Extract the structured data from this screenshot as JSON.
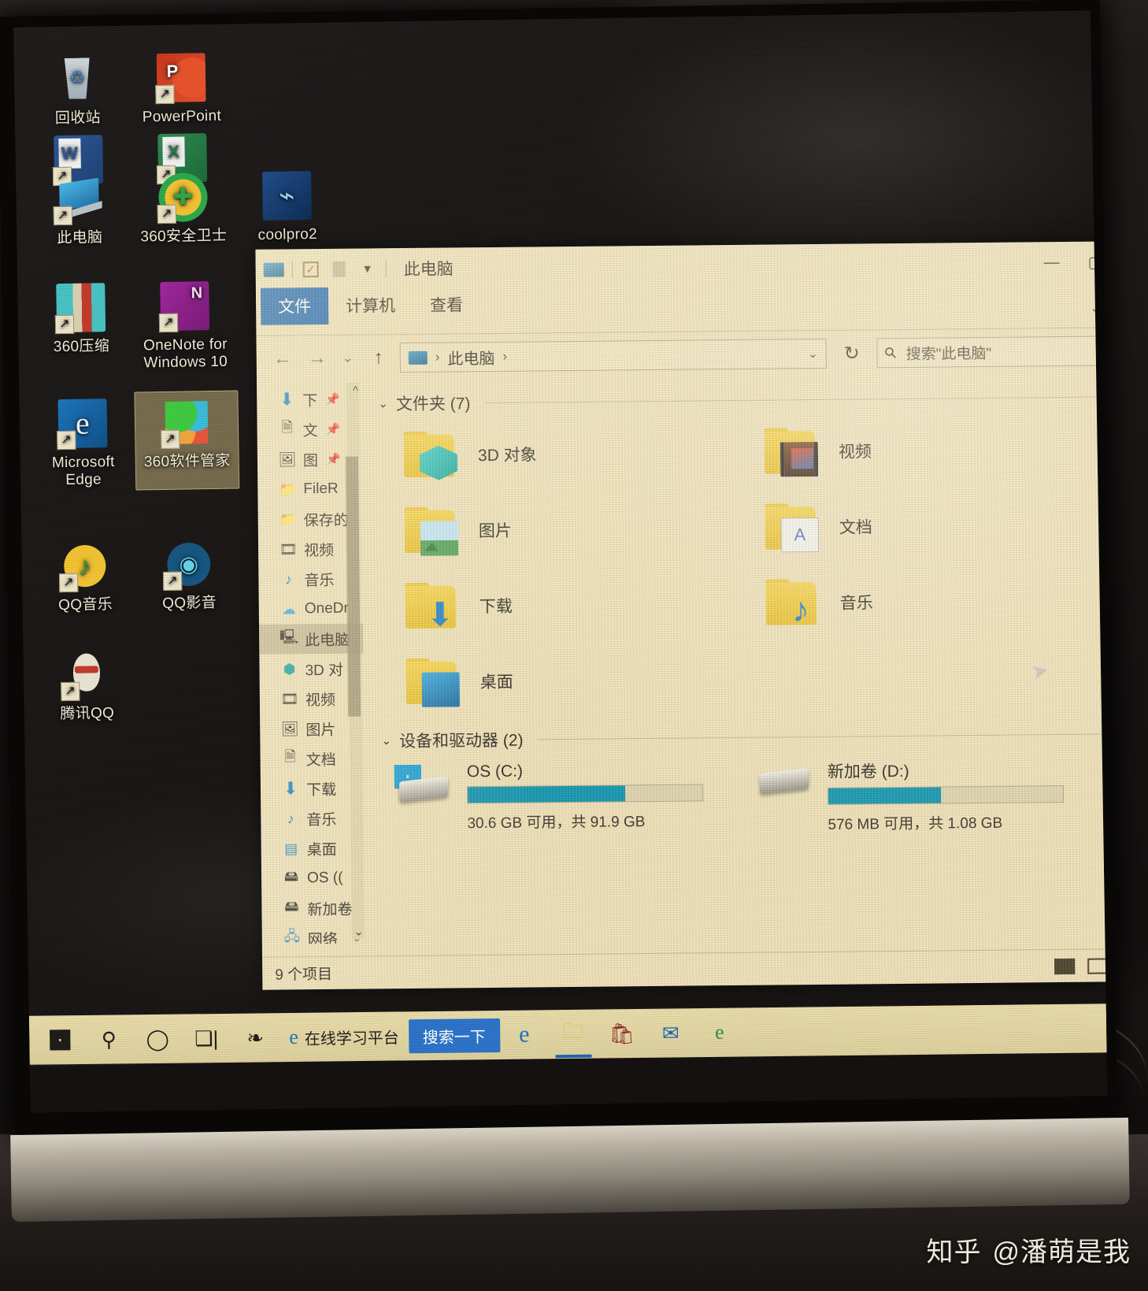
{
  "desktop": {
    "icons": [
      {
        "label": "回收站",
        "art": "i-recycle",
        "shortcut": false,
        "selected": false
      },
      {
        "label": "PowerPoint",
        "art": "i-ppt",
        "letter": "P",
        "shortcut": true,
        "selected": false
      },
      {
        "label": "Word",
        "art": "i-word",
        "letter": "W",
        "shortcut": true,
        "selected": false
      },
      {
        "label": "Excel",
        "art": "i-excel",
        "letter": "X",
        "shortcut": true,
        "selected": false
      },
      {
        "label": "此电脑",
        "art": "i-pc",
        "shortcut": true,
        "selected": false
      },
      {
        "label": "360安全卫士",
        "art": "i-360",
        "shortcut": true,
        "selected": false
      },
      {
        "label": "coolpro2",
        "art": "i-cool",
        "shortcut": false,
        "selected": false
      },
      {
        "label": "360压缩",
        "art": "i-zip",
        "shortcut": true,
        "selected": false
      },
      {
        "label": "OneNote for Windows 10",
        "art": "i-onenote",
        "shortcut": true,
        "selected": false
      },
      {
        "label": "Microsoft Edge",
        "art": "i-edge",
        "shortcut": true,
        "selected": false
      },
      {
        "label": "360软件管家",
        "art": "i-360sw",
        "shortcut": true,
        "selected": true
      },
      {
        "label": "QQ音乐",
        "art": "i-qqmusic",
        "shortcut": true,
        "selected": false
      },
      {
        "label": "QQ影音",
        "art": "i-qqvideo",
        "shortcut": true,
        "selected": false
      },
      {
        "label": "腾讯QQ",
        "art": "i-qq",
        "shortcut": true,
        "selected": false
      }
    ]
  },
  "explorer": {
    "title": "此电脑",
    "quick_access": {
      "properties_icon": "properties-checkbox-icon",
      "new_folder_icon": "new-folder-icon",
      "customize_icon": "chevron-down-icon"
    },
    "window_controls": {
      "minimize": "—",
      "maximize": "▢",
      "close": "✕"
    },
    "tabs": [
      {
        "label": "文件",
        "active": true
      },
      {
        "label": "计算机",
        "active": false
      },
      {
        "label": "查看",
        "active": false
      }
    ],
    "nav": {
      "back": "←",
      "forward": "→",
      "recent": "⌄",
      "up": "↑"
    },
    "address": {
      "crumb1": "此电脑",
      "sep": "›",
      "lead_sep": "›"
    },
    "refresh_label": "↻",
    "search": {
      "placeholder": "搜索\"此电脑\""
    },
    "sidebar": [
      {
        "label": "下",
        "icon": "download-icon",
        "pinned": true,
        "selected": false
      },
      {
        "label": "文",
        "icon": "document-icon",
        "pinned": true,
        "selected": false
      },
      {
        "label": "图",
        "icon": "picture-icon",
        "pinned": true,
        "selected": false
      },
      {
        "label": "FileR",
        "icon": "folder-icon",
        "pinned": false,
        "selected": false
      },
      {
        "label": "保存的",
        "icon": "folder-icon",
        "pinned": false,
        "selected": false
      },
      {
        "label": "视频",
        "icon": "video-icon",
        "pinned": false,
        "selected": false
      },
      {
        "label": "音乐",
        "icon": "music-icon",
        "pinned": false,
        "selected": false
      },
      {
        "label": "OneDr",
        "icon": "onedrive-icon",
        "pinned": false,
        "selected": false
      },
      {
        "label": "此电脑",
        "icon": "this-pc-icon",
        "pinned": false,
        "selected": true
      },
      {
        "label": "3D 对",
        "icon": "3d-objects-icon",
        "pinned": false,
        "selected": false
      },
      {
        "label": "视频",
        "icon": "video-icon",
        "pinned": false,
        "selected": false
      },
      {
        "label": "图片",
        "icon": "picture-icon",
        "pinned": false,
        "selected": false
      },
      {
        "label": "文档",
        "icon": "document-icon",
        "pinned": false,
        "selected": false
      },
      {
        "label": "下载",
        "icon": "download-icon",
        "pinned": false,
        "selected": false
      },
      {
        "label": "音乐",
        "icon": "music-icon",
        "pinned": false,
        "selected": false
      },
      {
        "label": "桌面",
        "icon": "desktop-icon",
        "pinned": false,
        "selected": false
      },
      {
        "label": "OS ((",
        "icon": "drive-icon",
        "pinned": false,
        "selected": false
      },
      {
        "label": "新加卷",
        "icon": "drive-icon",
        "pinned": false,
        "selected": false
      },
      {
        "label": "网络",
        "icon": "network-icon",
        "pinned": false,
        "selected": false
      }
    ],
    "groups": {
      "folders": {
        "header": "文件夹 (7)",
        "items": [
          {
            "name": "3D 对象",
            "art": "b-3d"
          },
          {
            "name": "视频",
            "art": "b-vid"
          },
          {
            "name": "图片",
            "art": "b-pic"
          },
          {
            "name": "文档",
            "art": "b-doc"
          },
          {
            "name": "下载",
            "art": "b-dl"
          },
          {
            "name": "音乐",
            "art": "b-mus"
          },
          {
            "name": "桌面",
            "art": "b-desk"
          }
        ]
      },
      "drives": {
        "header": "设备和驱动器 (2)",
        "items": [
          {
            "name": "OS (C:)",
            "capacity": "30.6 GB 可用，共 91.9 GB",
            "used_percent": 67,
            "type": "windows"
          },
          {
            "name": "新加卷 (D:)",
            "capacity": "576 MB 可用，共 1.08 GB",
            "used_percent": 48,
            "type": "plain"
          }
        ]
      }
    },
    "status": {
      "items": "9 个项目",
      "view_details": "details-view-icon",
      "view_large": "large-icons-view-icon"
    }
  },
  "taskbar": {
    "start": "start-button",
    "search_icon": "search-icon",
    "cortana_icon": "cortana-circle-icon",
    "taskview_icon": "task-view-icon",
    "items": [
      {
        "name": "360-icon",
        "label": ""
      },
      {
        "name": "edge-icon",
        "label": "在线学习平台"
      }
    ],
    "search_pill": "搜索一下",
    "pinned": [
      {
        "name": "edge-icon"
      },
      {
        "name": "file-explorer-icon",
        "active": true
      },
      {
        "name": "store-icon"
      },
      {
        "name": "mail-icon"
      },
      {
        "name": "internet-explorer-icon"
      }
    ]
  },
  "watermark": {
    "site": "知乎",
    "user": "@潘萌是我"
  }
}
